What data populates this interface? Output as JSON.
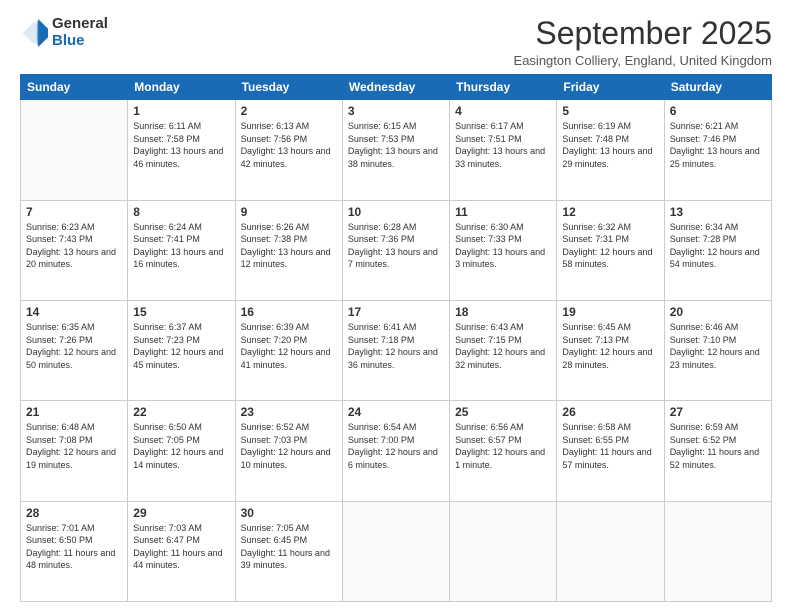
{
  "logo": {
    "general": "General",
    "blue": "Blue"
  },
  "title": "September 2025",
  "subtitle": "Easington Colliery, England, United Kingdom",
  "days_of_week": [
    "Sunday",
    "Monday",
    "Tuesday",
    "Wednesday",
    "Thursday",
    "Friday",
    "Saturday"
  ],
  "weeks": [
    [
      {
        "day": "",
        "info": ""
      },
      {
        "day": "1",
        "info": "Sunrise: 6:11 AM\nSunset: 7:58 PM\nDaylight: 13 hours and 46 minutes."
      },
      {
        "day": "2",
        "info": "Sunrise: 6:13 AM\nSunset: 7:56 PM\nDaylight: 13 hours and 42 minutes."
      },
      {
        "day": "3",
        "info": "Sunrise: 6:15 AM\nSunset: 7:53 PM\nDaylight: 13 hours and 38 minutes."
      },
      {
        "day": "4",
        "info": "Sunrise: 6:17 AM\nSunset: 7:51 PM\nDaylight: 13 hours and 33 minutes."
      },
      {
        "day": "5",
        "info": "Sunrise: 6:19 AM\nSunset: 7:48 PM\nDaylight: 13 hours and 29 minutes."
      },
      {
        "day": "6",
        "info": "Sunrise: 6:21 AM\nSunset: 7:46 PM\nDaylight: 13 hours and 25 minutes."
      }
    ],
    [
      {
        "day": "7",
        "info": "Sunrise: 6:23 AM\nSunset: 7:43 PM\nDaylight: 13 hours and 20 minutes."
      },
      {
        "day": "8",
        "info": "Sunrise: 6:24 AM\nSunset: 7:41 PM\nDaylight: 13 hours and 16 minutes."
      },
      {
        "day": "9",
        "info": "Sunrise: 6:26 AM\nSunset: 7:38 PM\nDaylight: 13 hours and 12 minutes."
      },
      {
        "day": "10",
        "info": "Sunrise: 6:28 AM\nSunset: 7:36 PM\nDaylight: 13 hours and 7 minutes."
      },
      {
        "day": "11",
        "info": "Sunrise: 6:30 AM\nSunset: 7:33 PM\nDaylight: 13 hours and 3 minutes."
      },
      {
        "day": "12",
        "info": "Sunrise: 6:32 AM\nSunset: 7:31 PM\nDaylight: 12 hours and 58 minutes."
      },
      {
        "day": "13",
        "info": "Sunrise: 6:34 AM\nSunset: 7:28 PM\nDaylight: 12 hours and 54 minutes."
      }
    ],
    [
      {
        "day": "14",
        "info": "Sunrise: 6:35 AM\nSunset: 7:26 PM\nDaylight: 12 hours and 50 minutes."
      },
      {
        "day": "15",
        "info": "Sunrise: 6:37 AM\nSunset: 7:23 PM\nDaylight: 12 hours and 45 minutes."
      },
      {
        "day": "16",
        "info": "Sunrise: 6:39 AM\nSunset: 7:20 PM\nDaylight: 12 hours and 41 minutes."
      },
      {
        "day": "17",
        "info": "Sunrise: 6:41 AM\nSunset: 7:18 PM\nDaylight: 12 hours and 36 minutes."
      },
      {
        "day": "18",
        "info": "Sunrise: 6:43 AM\nSunset: 7:15 PM\nDaylight: 12 hours and 32 minutes."
      },
      {
        "day": "19",
        "info": "Sunrise: 6:45 AM\nSunset: 7:13 PM\nDaylight: 12 hours and 28 minutes."
      },
      {
        "day": "20",
        "info": "Sunrise: 6:46 AM\nSunset: 7:10 PM\nDaylight: 12 hours and 23 minutes."
      }
    ],
    [
      {
        "day": "21",
        "info": "Sunrise: 6:48 AM\nSunset: 7:08 PM\nDaylight: 12 hours and 19 minutes."
      },
      {
        "day": "22",
        "info": "Sunrise: 6:50 AM\nSunset: 7:05 PM\nDaylight: 12 hours and 14 minutes."
      },
      {
        "day": "23",
        "info": "Sunrise: 6:52 AM\nSunset: 7:03 PM\nDaylight: 12 hours and 10 minutes."
      },
      {
        "day": "24",
        "info": "Sunrise: 6:54 AM\nSunset: 7:00 PM\nDaylight: 12 hours and 6 minutes."
      },
      {
        "day": "25",
        "info": "Sunrise: 6:56 AM\nSunset: 6:57 PM\nDaylight: 12 hours and 1 minute."
      },
      {
        "day": "26",
        "info": "Sunrise: 6:58 AM\nSunset: 6:55 PM\nDaylight: 11 hours and 57 minutes."
      },
      {
        "day": "27",
        "info": "Sunrise: 6:59 AM\nSunset: 6:52 PM\nDaylight: 11 hours and 52 minutes."
      }
    ],
    [
      {
        "day": "28",
        "info": "Sunrise: 7:01 AM\nSunset: 6:50 PM\nDaylight: 11 hours and 48 minutes."
      },
      {
        "day": "29",
        "info": "Sunrise: 7:03 AM\nSunset: 6:47 PM\nDaylight: 11 hours and 44 minutes."
      },
      {
        "day": "30",
        "info": "Sunrise: 7:05 AM\nSunset: 6:45 PM\nDaylight: 11 hours and 39 minutes."
      },
      {
        "day": "",
        "info": ""
      },
      {
        "day": "",
        "info": ""
      },
      {
        "day": "",
        "info": ""
      },
      {
        "day": "",
        "info": ""
      }
    ]
  ]
}
